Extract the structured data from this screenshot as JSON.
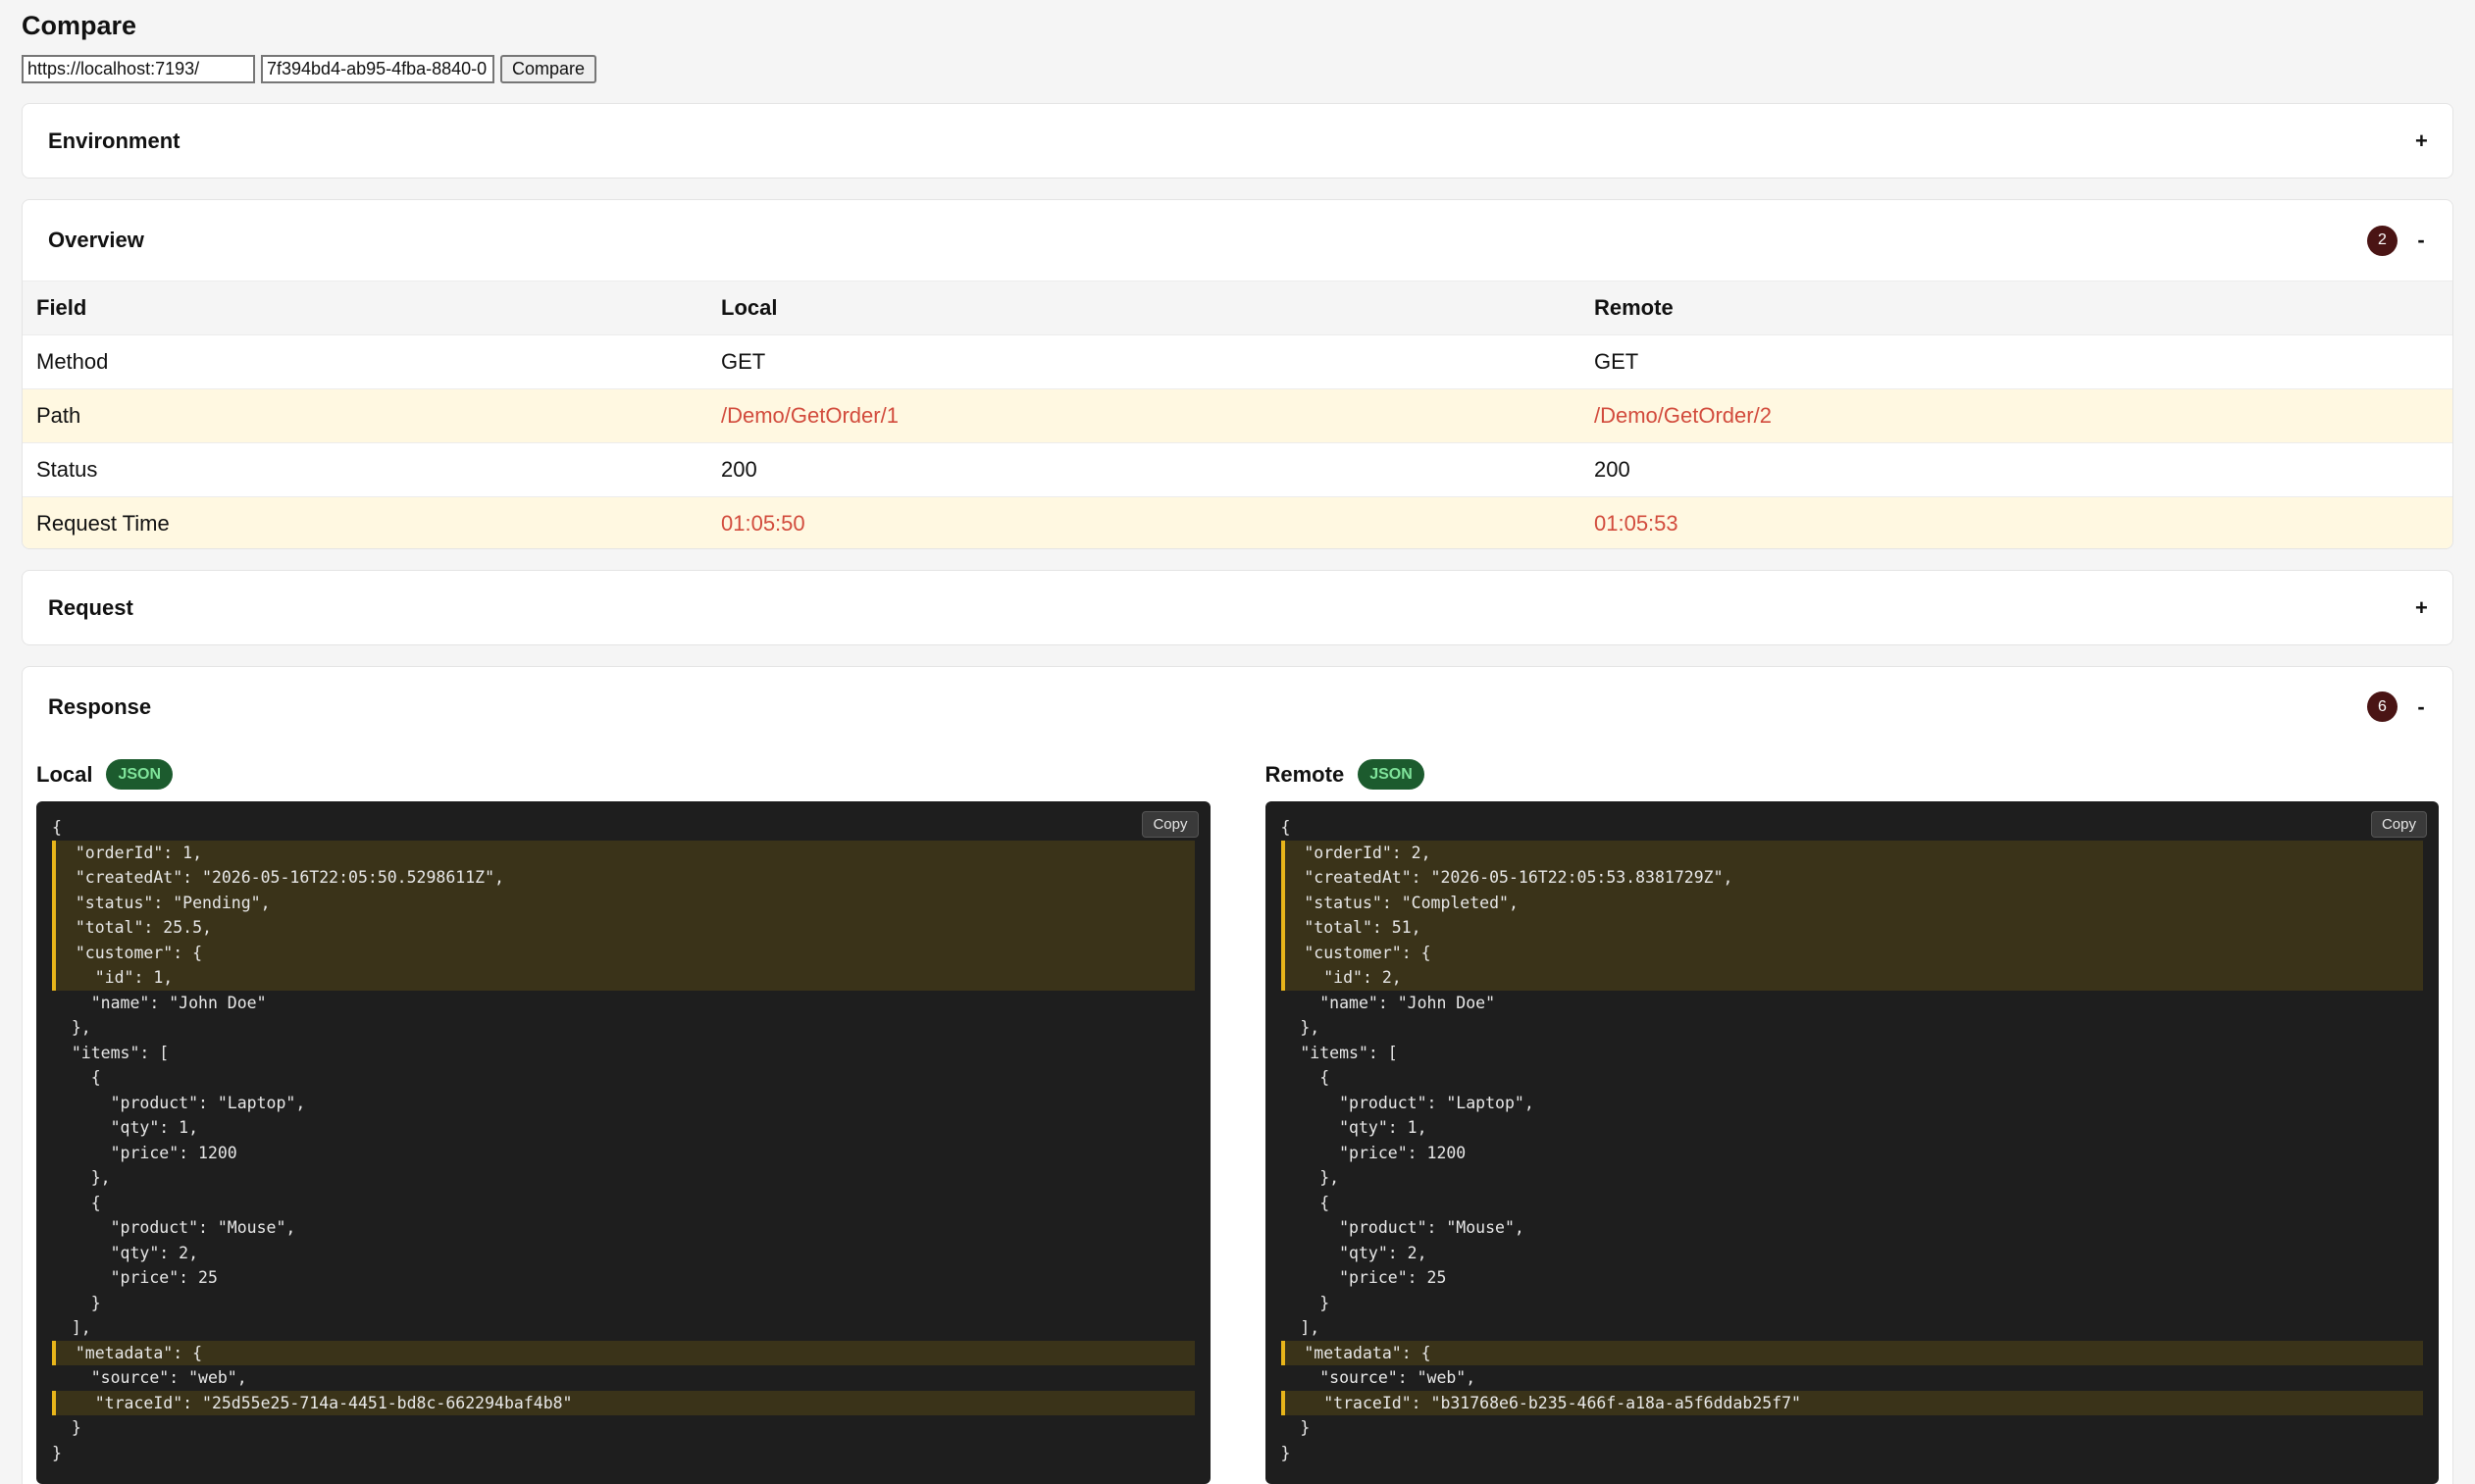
{
  "page": {
    "title": "Compare"
  },
  "controls": {
    "url_value": "https://localhost:7193/",
    "id_value": "7f394bd4-ab95-4fba-8840-0",
    "compare_label": "Compare"
  },
  "sections": {
    "environment": {
      "title": "Environment",
      "toggle": "+"
    },
    "overview": {
      "title": "Overview",
      "badge": "2",
      "toggle": "-"
    },
    "request": {
      "title": "Request",
      "toggle": "+"
    },
    "response": {
      "title": "Response",
      "badge": "6",
      "toggle": "-"
    }
  },
  "overview_table": {
    "headers": [
      "Field",
      "Local",
      "Remote"
    ],
    "rows": [
      {
        "field": "Method",
        "local": "GET",
        "remote": "GET",
        "diff": false
      },
      {
        "field": "Path",
        "local": "/Demo/GetOrder/1",
        "remote": "/Demo/GetOrder/2",
        "diff": true
      },
      {
        "field": "Status",
        "local": "200",
        "remote": "200",
        "diff": false
      },
      {
        "field": "Request Time",
        "local": "01:05:50",
        "remote": "01:05:53",
        "diff": true
      }
    ]
  },
  "response": {
    "copy_label": "Copy",
    "local": {
      "label": "Local",
      "format": "JSON",
      "lines": [
        {
          "text": "{",
          "hl": false
        },
        {
          "text": "  \"orderId\": 1,",
          "hl": true
        },
        {
          "text": "  \"createdAt\": \"2026-05-16T22:05:50.5298611Z\",",
          "hl": true
        },
        {
          "text": "  \"status\": \"Pending\",",
          "hl": true
        },
        {
          "text": "  \"total\": 25.5,",
          "hl": true
        },
        {
          "text": "  \"customer\": {",
          "hl": true
        },
        {
          "text": "    \"id\": 1,",
          "hl": true
        },
        {
          "text": "    \"name\": \"John Doe\"",
          "hl": false
        },
        {
          "text": "  },",
          "hl": false
        },
        {
          "text": "  \"items\": [",
          "hl": false
        },
        {
          "text": "    {",
          "hl": false
        },
        {
          "text": "      \"product\": \"Laptop\",",
          "hl": false
        },
        {
          "text": "      \"qty\": 1,",
          "hl": false
        },
        {
          "text": "      \"price\": 1200",
          "hl": false
        },
        {
          "text": "    },",
          "hl": false
        },
        {
          "text": "    {",
          "hl": false
        },
        {
          "text": "      \"product\": \"Mouse\",",
          "hl": false
        },
        {
          "text": "      \"qty\": 2,",
          "hl": false
        },
        {
          "text": "      \"price\": 25",
          "hl": false
        },
        {
          "text": "    }",
          "hl": false
        },
        {
          "text": "  ],",
          "hl": false
        },
        {
          "text": "  \"metadata\": {",
          "hl": true
        },
        {
          "text": "    \"source\": \"web\",",
          "hl": false
        },
        {
          "text": "    \"traceId\": \"25d55e25-714a-4451-bd8c-662294baf4b8\"",
          "hl": true
        },
        {
          "text": "  }",
          "hl": false
        },
        {
          "text": "}",
          "hl": false
        }
      ]
    },
    "remote": {
      "label": "Remote",
      "format": "JSON",
      "lines": [
        {
          "text": "{",
          "hl": false
        },
        {
          "text": "  \"orderId\": 2,",
          "hl": true
        },
        {
          "text": "  \"createdAt\": \"2026-05-16T22:05:53.8381729Z\",",
          "hl": true
        },
        {
          "text": "  \"status\": \"Completed\",",
          "hl": true
        },
        {
          "text": "  \"total\": 51,",
          "hl": true
        },
        {
          "text": "  \"customer\": {",
          "hl": true
        },
        {
          "text": "    \"id\": 2,",
          "hl": true
        },
        {
          "text": "    \"name\": \"John Doe\"",
          "hl": false
        },
        {
          "text": "  },",
          "hl": false
        },
        {
          "text": "  \"items\": [",
          "hl": false
        },
        {
          "text": "    {",
          "hl": false
        },
        {
          "text": "      \"product\": \"Laptop\",",
          "hl": false
        },
        {
          "text": "      \"qty\": 1,",
          "hl": false
        },
        {
          "text": "      \"price\": 1200",
          "hl": false
        },
        {
          "text": "    },",
          "hl": false
        },
        {
          "text": "    {",
          "hl": false
        },
        {
          "text": "      \"product\": \"Mouse\",",
          "hl": false
        },
        {
          "text": "      \"qty\": 2,",
          "hl": false
        },
        {
          "text": "      \"price\": 25",
          "hl": false
        },
        {
          "text": "    }",
          "hl": false
        },
        {
          "text": "  ],",
          "hl": false
        },
        {
          "text": "  \"metadata\": {",
          "hl": true
        },
        {
          "text": "    \"source\": \"web\",",
          "hl": false
        },
        {
          "text": "    \"traceId\": \"b31768e6-b235-466f-a18a-a5f6ddab25f7\"",
          "hl": true
        },
        {
          "text": "  }",
          "hl": false
        },
        {
          "text": "}",
          "hl": false
        }
      ]
    }
  }
}
